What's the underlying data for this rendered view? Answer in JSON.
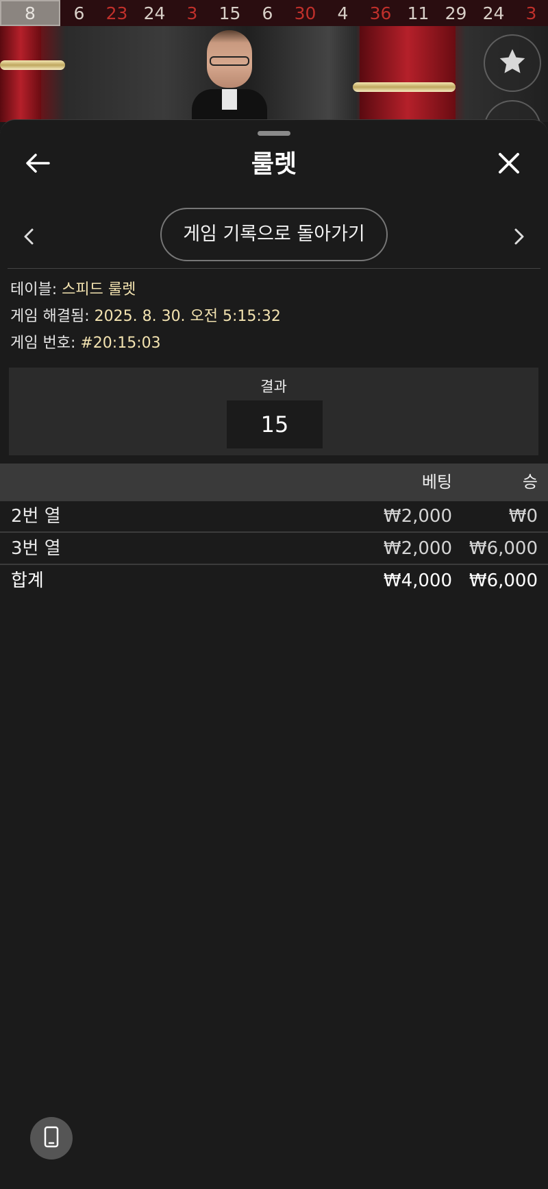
{
  "history": {
    "numbers": [
      {
        "value": "8",
        "color": "gray"
      },
      {
        "value": "6",
        "color": "black"
      },
      {
        "value": "23",
        "color": "red"
      },
      {
        "value": "24",
        "color": "black"
      },
      {
        "value": "3",
        "color": "red"
      },
      {
        "value": "15",
        "color": "black"
      },
      {
        "value": "6",
        "color": "black"
      },
      {
        "value": "30",
        "color": "red"
      },
      {
        "value": "4",
        "color": "black"
      },
      {
        "value": "36",
        "color": "red"
      },
      {
        "value": "11",
        "color": "black"
      },
      {
        "value": "29",
        "color": "black"
      },
      {
        "value": "24",
        "color": "black"
      },
      {
        "value": "3",
        "color": "red"
      }
    ]
  },
  "icons": {
    "favorite": "star-icon",
    "back": "arrow-left-icon",
    "close": "close-icon",
    "prev": "chevron-left-icon",
    "next": "chevron-right-icon",
    "device": "mobile-device-icon"
  },
  "header": {
    "title": "룰렛"
  },
  "nav": {
    "back_to_history": "게임 기록으로 돌아가기"
  },
  "details": {
    "table_label": "테이블:",
    "table_value": "스피드 룰렛",
    "resolved_label": "게임 해결됨:",
    "resolved_value": "2025. 8. 30. 오전 5:15:32",
    "round_label": "게임 번호:",
    "round_value": "#20:15:03"
  },
  "result": {
    "label": "결과",
    "number": "15"
  },
  "bets_table": {
    "headers": {
      "bet": "베팅",
      "win": "승"
    },
    "rows": [
      {
        "name": "2번 열",
        "bet": "₩2,000",
        "win": "₩0"
      },
      {
        "name": "3번 열",
        "bet": "₩2,000",
        "win": "₩6,000"
      }
    ],
    "total": {
      "name": "합계",
      "bet": "₩4,000",
      "win": "₩6,000"
    }
  },
  "colors": {
    "red_number": "#c0302b",
    "value_text": "#f3e3b0",
    "sheet_bg": "#1b1b1b"
  }
}
